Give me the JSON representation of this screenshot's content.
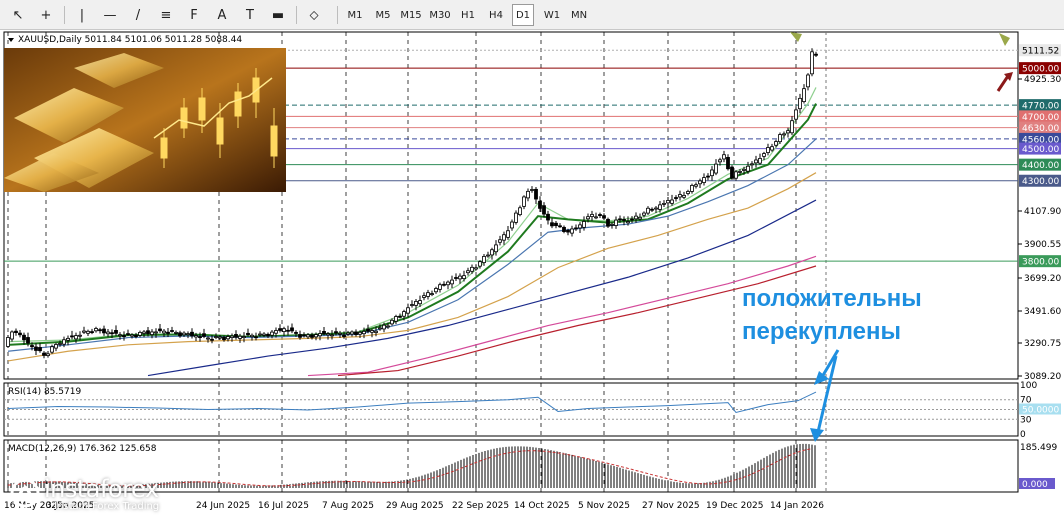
{
  "toolbar": {
    "tools": [
      {
        "name": "cursor-tool",
        "glyph": "↖"
      },
      {
        "name": "crosshair-tool",
        "glyph": "+"
      },
      {
        "name": "vertical-line-tool",
        "glyph": "|"
      },
      {
        "name": "horizontal-line-tool",
        "glyph": "—"
      },
      {
        "name": "trend-line-tool",
        "glyph": "/"
      },
      {
        "name": "channel-tool",
        "glyph": "≡"
      },
      {
        "name": "fibonacci-tool",
        "glyph": "F"
      },
      {
        "name": "text-tool",
        "glyph": "A"
      },
      {
        "name": "text-label-tool",
        "glyph": "T"
      },
      {
        "name": "rectangle-tool",
        "glyph": "▬"
      },
      {
        "name": "arrows-tool",
        "glyph": "⬦"
      }
    ],
    "timeframes": [
      "M1",
      "M5",
      "M15",
      "M30",
      "H1",
      "H4",
      "D1",
      "W1",
      "MN"
    ],
    "active_timeframe": "D1"
  },
  "chart_title": "XAUUSD,Daily  5011.84 5101.06 5011.28 5088.44",
  "logo": {
    "title": "instaforex",
    "subtitle": "Instant Forex Trading"
  },
  "annotation": {
    "line1": "положительны",
    "line2": "перекуплены"
  },
  "rsi_label": "RSI(14) 85.5719",
  "macd_label": "MACD(12,26,9) 176.362 125.658",
  "colors": {
    "bull": "#2f6a2f",
    "up_candle_fill": "#ffffff",
    "ema_fast": "#90d090",
    "ema_mid": "#1f7a1f",
    "ema_slow": "#4a76b0",
    "sma100": "#d4a24c",
    "sma200": "#1a2a8a",
    "sma_pink": "#d44a9a",
    "sma_red": "#b8202e",
    "rsi_line": "#3d7fc0",
    "annotation": "#1e8fe0"
  },
  "chart_data": {
    "type": "candlestick",
    "symbol": "XAUUSD",
    "timeframe": "Daily",
    "ohlc": {
      "open": 5011.84,
      "high": 5101.06,
      "low": 5011.28,
      "close": 5088.44
    },
    "x_ticks": [
      "16 May 2025",
      "3 Jun 2025",
      "24 Jun 2025",
      "16 Jul 2025",
      "7 Aug 2025",
      "29 Aug 2025",
      "22 Sep 2025",
      "14 Oct 2025",
      "5 Nov 2025",
      "27 Nov 2025",
      "19 Dec 2025",
      "14 Jan 2026"
    ],
    "y_ticks": [
      "4925.30",
      "4107.90",
      "3900.55",
      "3699.20",
      "3491.60",
      "3290.75",
      "3089.20"
    ],
    "ylim": [
      3080,
      5150
    ],
    "price_levels": [
      {
        "value": 5111.52,
        "label": "5111.52",
        "color": "#b0b0b0",
        "style": "dotted"
      },
      {
        "value": 5000.0,
        "label": "5000.00",
        "color": "#8b0000",
        "style": "solid"
      },
      {
        "value": 4770.0,
        "label": "4770.00",
        "color": "#1f6b6b",
        "style": "dashed"
      },
      {
        "value": 4700.0,
        "label": "4700.00",
        "color": "#e07070",
        "style": "solid"
      },
      {
        "value": 4630.0,
        "label": "4630.00",
        "color": "#e08080",
        "style": "solid"
      },
      {
        "value": 4560.0,
        "label": "4560.00",
        "color": "#3a4a9a",
        "style": "dashed"
      },
      {
        "value": 4500.0,
        "label": "4500.00",
        "color": "#6a5acd",
        "style": "solid"
      },
      {
        "value": 4400.0,
        "label": "4400.00",
        "color": "#2e8b57",
        "style": "solid"
      },
      {
        "value": 4300.0,
        "label": "4300.00",
        "color": "#4a5a8a",
        "style": "solid"
      },
      {
        "value": 3800.0,
        "label": "3800.00",
        "color": "#3a9a5a",
        "style": "solid"
      }
    ],
    "price_path": [
      [
        0,
        3270
      ],
      [
        10,
        3380
      ],
      [
        20,
        3310
      ],
      [
        30,
        3260
      ],
      [
        40,
        3215
      ],
      [
        55,
        3295
      ],
      [
        70,
        3335
      ],
      [
        90,
        3375
      ],
      [
        110,
        3350
      ],
      [
        125,
        3335
      ],
      [
        140,
        3355
      ],
      [
        160,
        3365
      ],
      [
        175,
        3350
      ],
      [
        190,
        3340
      ],
      [
        205,
        3320
      ],
      [
        220,
        3325
      ],
      [
        240,
        3335
      ],
      [
        260,
        3340
      ],
      [
        280,
        3380
      ],
      [
        300,
        3330
      ],
      [
        320,
        3350
      ],
      [
        340,
        3345
      ],
      [
        360,
        3360
      ],
      [
        375,
        3375
      ],
      [
        385,
        3415
      ],
      [
        395,
        3460
      ],
      [
        410,
        3540
      ],
      [
        425,
        3600
      ],
      [
        440,
        3660
      ],
      [
        455,
        3700
      ],
      [
        470,
        3760
      ],
      [
        485,
        3850
      ],
      [
        500,
        3960
      ],
      [
        510,
        4060
      ],
      [
        520,
        4200
      ],
      [
        528,
        4250
      ],
      [
        535,
        4140
      ],
      [
        545,
        4040
      ],
      [
        555,
        4010
      ],
      [
        565,
        3980
      ],
      [
        575,
        4020
      ],
      [
        585,
        4080
      ],
      [
        595,
        4090
      ],
      [
        605,
        4020
      ],
      [
        615,
        4060
      ],
      [
        625,
        4050
      ],
      [
        635,
        4080
      ],
      [
        645,
        4120
      ],
      [
        655,
        4140
      ],
      [
        665,
        4180
      ],
      [
        675,
        4200
      ],
      [
        685,
        4240
      ],
      [
        695,
        4300
      ],
      [
        705,
        4330
      ],
      [
        712,
        4410
      ],
      [
        720,
        4450
      ],
      [
        728,
        4320
      ],
      [
        735,
        4360
      ],
      [
        745,
        4390
      ],
      [
        755,
        4440
      ],
      [
        765,
        4500
      ],
      [
        775,
        4570
      ],
      [
        785,
        4620
      ],
      [
        792,
        4740
      ],
      [
        798,
        4840
      ],
      [
        804,
        4960
      ],
      [
        808,
        5088
      ]
    ],
    "ma_lines": [
      {
        "name": "EMA fast",
        "colorKey": "ema_fast",
        "pts": [
          [
            0,
            3300
          ],
          [
            60,
            3310
          ],
          [
            120,
            3345
          ],
          [
            180,
            3345
          ],
          [
            240,
            3330
          ],
          [
            300,
            3345
          ],
          [
            350,
            3360
          ],
          [
            400,
            3480
          ],
          [
            450,
            3650
          ],
          [
            500,
            3920
          ],
          [
            530,
            4160
          ],
          [
            560,
            4060
          ],
          [
            600,
            4050
          ],
          [
            640,
            4080
          ],
          [
            680,
            4190
          ],
          [
            720,
            4340
          ],
          [
            760,
            4440
          ],
          [
            800,
            4780
          ],
          [
            808,
            4880
          ]
        ]
      },
      {
        "name": "EMA mid",
        "colorKey": "ema_mid",
        "pts": [
          [
            0,
            3280
          ],
          [
            60,
            3300
          ],
          [
            120,
            3340
          ],
          [
            180,
            3345
          ],
          [
            240,
            3330
          ],
          [
            300,
            3340
          ],
          [
            350,
            3355
          ],
          [
            400,
            3450
          ],
          [
            450,
            3610
          ],
          [
            500,
            3860
          ],
          [
            530,
            4080
          ],
          [
            560,
            4060
          ],
          [
            600,
            4040
          ],
          [
            640,
            4060
          ],
          [
            680,
            4160
          ],
          [
            720,
            4310
          ],
          [
            760,
            4400
          ],
          [
            800,
            4680
          ],
          [
            808,
            4780
          ]
        ]
      },
      {
        "name": "EMA slow",
        "colorKey": "ema_slow",
        "pts": [
          [
            0,
            3240
          ],
          [
            60,
            3280
          ],
          [
            120,
            3325
          ],
          [
            180,
            3335
          ],
          [
            240,
            3325
          ],
          [
            300,
            3335
          ],
          [
            350,
            3345
          ],
          [
            400,
            3420
          ],
          [
            450,
            3560
          ],
          [
            500,
            3780
          ],
          [
            540,
            3980
          ],
          [
            580,
            4010
          ],
          [
            620,
            4030
          ],
          [
            660,
            4080
          ],
          [
            700,
            4170
          ],
          [
            740,
            4270
          ],
          [
            780,
            4400
          ],
          [
            808,
            4560
          ]
        ]
      },
      {
        "name": "SMA 100",
        "colorKey": "sma100",
        "pts": [
          [
            0,
            3180
          ],
          [
            60,
            3240
          ],
          [
            120,
            3280
          ],
          [
            180,
            3300
          ],
          [
            240,
            3310
          ],
          [
            300,
            3320
          ],
          [
            350,
            3330
          ],
          [
            400,
            3370
          ],
          [
            450,
            3450
          ],
          [
            500,
            3580
          ],
          [
            550,
            3760
          ],
          [
            600,
            3880
          ],
          [
            650,
            3960
          ],
          [
            700,
            4060
          ],
          [
            740,
            4130
          ],
          [
            780,
            4250
          ],
          [
            808,
            4350
          ]
        ]
      },
      {
        "name": "SMA 200",
        "colorKey": "sma200",
        "pts": [
          [
            140,
            3089
          ],
          [
            200,
            3150
          ],
          [
            260,
            3210
          ],
          [
            320,
            3260
          ],
          [
            380,
            3320
          ],
          [
            440,
            3400
          ],
          [
            500,
            3500
          ],
          [
            560,
            3600
          ],
          [
            620,
            3700
          ],
          [
            680,
            3820
          ],
          [
            740,
            3960
          ],
          [
            808,
            4180
          ]
        ]
      },
      {
        "name": "SMA pink",
        "colorKey": "sma_pink",
        "pts": [
          [
            300,
            3089
          ],
          [
            360,
            3110
          ],
          [
            420,
            3200
          ],
          [
            480,
            3300
          ],
          [
            540,
            3400
          ],
          [
            600,
            3480
          ],
          [
            660,
            3570
          ],
          [
            720,
            3660
          ],
          [
            780,
            3770
          ],
          [
            808,
            3830
          ]
        ]
      },
      {
        "name": "SMA red",
        "colorKey": "sma_red",
        "pts": [
          [
            330,
            3089
          ],
          [
            390,
            3120
          ],
          [
            450,
            3210
          ],
          [
            510,
            3310
          ],
          [
            570,
            3400
          ],
          [
            630,
            3480
          ],
          [
            690,
            3570
          ],
          [
            750,
            3660
          ],
          [
            808,
            3770
          ]
        ]
      }
    ],
    "rsi": {
      "levels": [
        100,
        70,
        50,
        30,
        0
      ],
      "current": 85.5719,
      "path": [
        [
          0,
          52
        ],
        [
          50,
          56
        ],
        [
          100,
          55
        ],
        [
          150,
          53
        ],
        [
          200,
          50
        ],
        [
          250,
          52
        ],
        [
          300,
          49
        ],
        [
          350,
          55
        ],
        [
          400,
          63
        ],
        [
          450,
          66
        ],
        [
          500,
          70
        ],
        [
          530,
          75
        ],
        [
          550,
          46
        ],
        [
          580,
          52
        ],
        [
          620,
          55
        ],
        [
          660,
          58
        ],
        [
          700,
          62
        ],
        [
          720,
          64
        ],
        [
          728,
          44
        ],
        [
          740,
          50
        ],
        [
          760,
          60
        ],
        [
          790,
          68
        ],
        [
          808,
          85.57
        ]
      ]
    },
    "macd": {
      "main": 176.362,
      "signal": 125.658,
      "levels": [
        "185.499",
        "0.000"
      ],
      "histogram_peak_x": 530
    }
  }
}
